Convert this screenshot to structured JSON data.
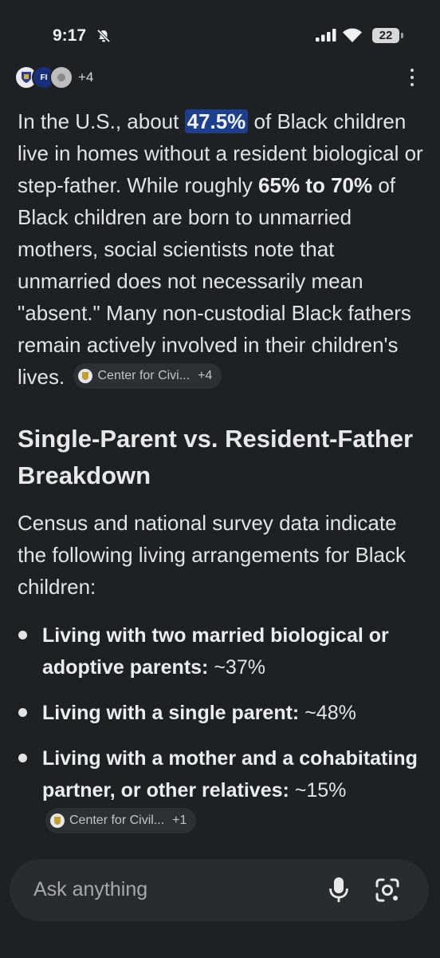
{
  "status_bar": {
    "time": "9:17",
    "battery": "22"
  },
  "sources": {
    "count_label": "+4",
    "avatar2_text": "FI"
  },
  "answer": {
    "p1_before": "In the U.S., about ",
    "p1_highlight": "47.5%",
    "p1_mid": " of Black children live in homes without a resident biological or step-father. While roughly ",
    "p1_bold": "65% to 70%",
    "p1_after": " of Black children are born to unmarried mothers, social scientists note that unmarried does not necessarily mean \"absent.\" Many non-custodial Black fathers remain actively involved in their children's lives.",
    "chip1_label": "Center for Civi...",
    "chip1_count": "+4"
  },
  "section": {
    "heading": "Single-Parent vs. Resident-Father Breakdown",
    "intro": "Census and national survey data indicate the following living arrangements for Black children:"
  },
  "bullets": [
    {
      "bold": "Living with two married biological or adoptive parents:",
      "value": " ~37%"
    },
    {
      "bold": "Living with a single parent:",
      "value": " ~48%"
    },
    {
      "bold": "Living with a mother and a cohabitating partner, or other relatives:",
      "value": " ~15%"
    }
  ],
  "chip2": {
    "label": "Center for Civil...",
    "count": "+1"
  },
  "ask": {
    "placeholder": "Ask anything"
  },
  "icons": {
    "status": [
      "bell-off-icon",
      "signal-icon",
      "wifi-icon",
      "battery-icon"
    ],
    "input": [
      "mic-icon",
      "lens-icon"
    ],
    "menu": "more-vert-icon"
  }
}
